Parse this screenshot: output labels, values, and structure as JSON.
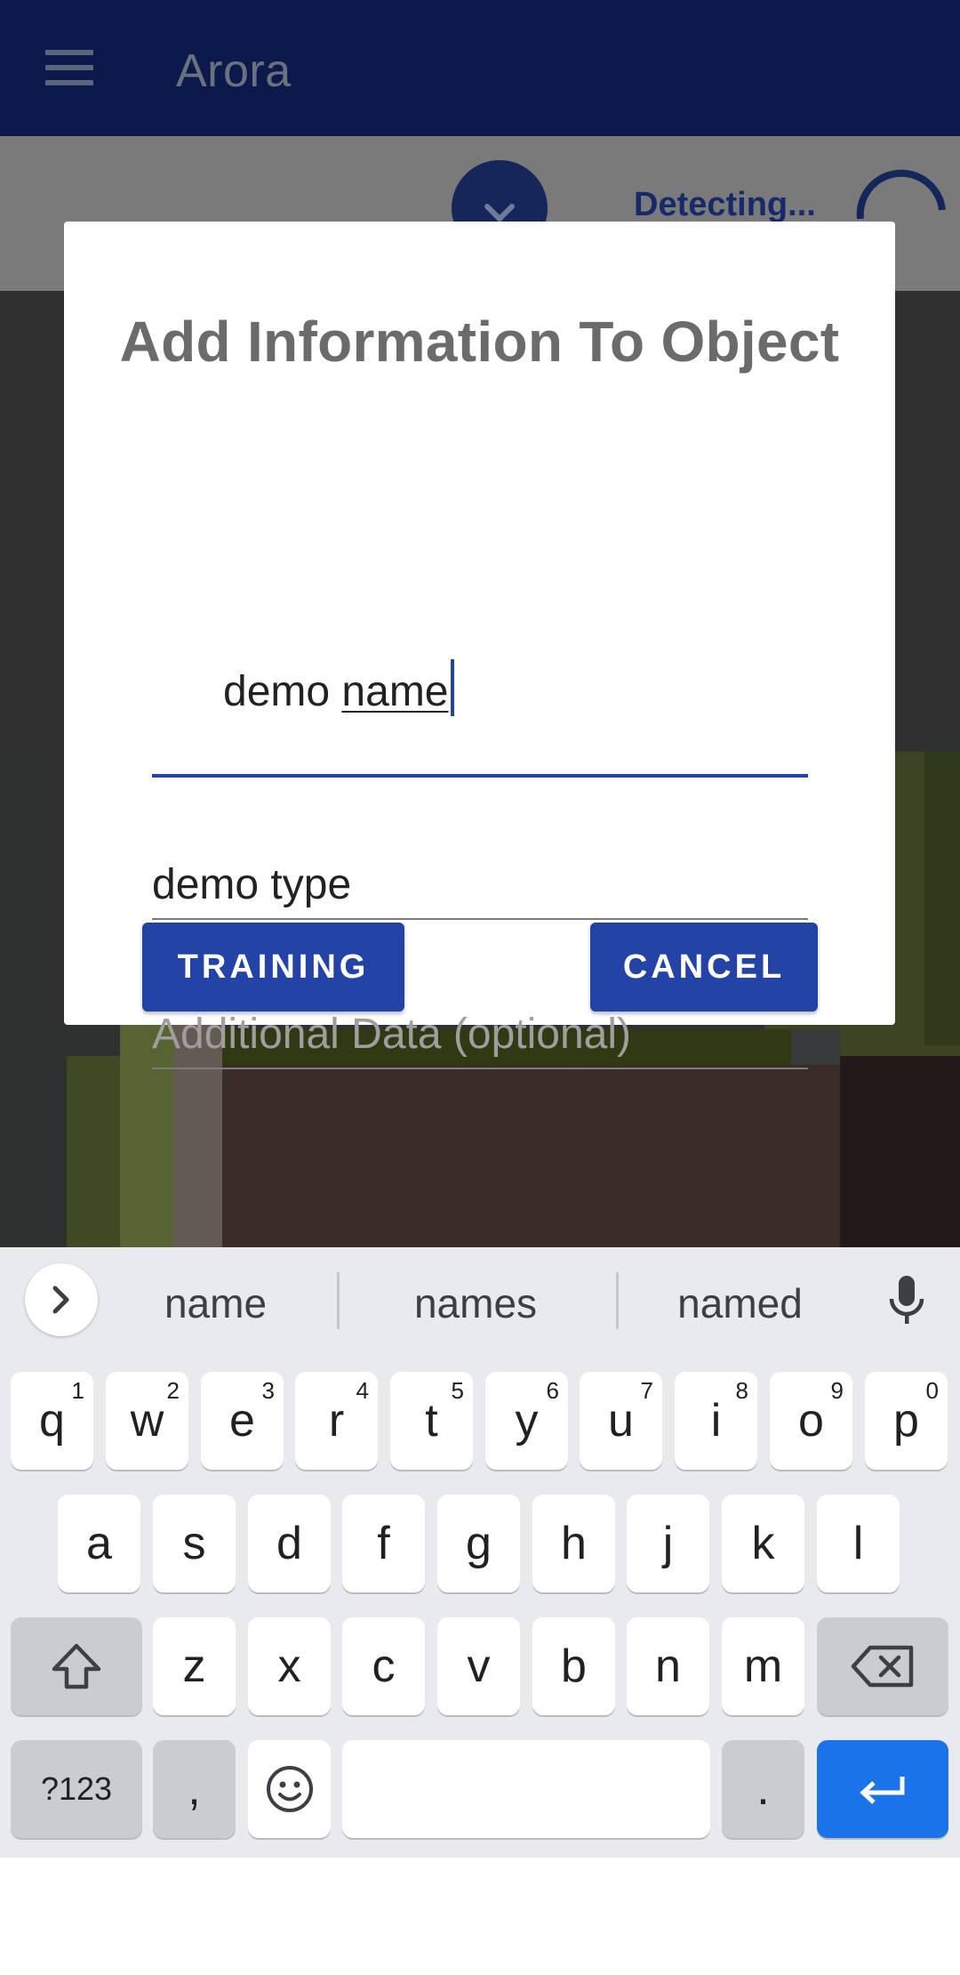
{
  "app_bar": {
    "title": "Arora",
    "menu_icon": "hamburger-menu-icon"
  },
  "detection_bar": {
    "status_text": "Detecting...",
    "collapse_icon": "chevron-down-icon",
    "progress_icon": "loading-spinner-icon"
  },
  "dialog": {
    "title": "Add Information To Object",
    "name_field": {
      "value_prefix": "demo ",
      "value_composing": "name",
      "placeholder": ""
    },
    "type_field": {
      "value": "demo type"
    },
    "data_field": {
      "value": "",
      "placeholder": "Additional Data (optional)"
    },
    "training_button": "TRAINING",
    "cancel_button": "CANCEL"
  },
  "colors": {
    "app_bar": "#0b1a4a",
    "accent": "#2443a6",
    "keyboard_bg": "#e8eaed",
    "enter_key": "#1a73e8"
  },
  "keyboard": {
    "suggestions": [
      "name",
      "names",
      "named"
    ],
    "row1": [
      {
        "k": "q",
        "n": "1"
      },
      {
        "k": "w",
        "n": "2"
      },
      {
        "k": "e",
        "n": "3"
      },
      {
        "k": "r",
        "n": "4"
      },
      {
        "k": "t",
        "n": "5"
      },
      {
        "k": "y",
        "n": "6"
      },
      {
        "k": "u",
        "n": "7"
      },
      {
        "k": "i",
        "n": "8"
      },
      {
        "k": "o",
        "n": "9"
      },
      {
        "k": "p",
        "n": "0"
      }
    ],
    "row2": [
      "a",
      "s",
      "d",
      "f",
      "g",
      "h",
      "j",
      "k",
      "l"
    ],
    "row3": [
      "z",
      "x",
      "c",
      "v",
      "b",
      "n",
      "m"
    ],
    "symbols_key": "?123",
    "comma_key": ",",
    "period_key": ".",
    "icons": [
      "shift-icon",
      "backspace-icon",
      "emoji-icon",
      "enter-icon",
      "microphone-icon",
      "expand-icon"
    ]
  }
}
